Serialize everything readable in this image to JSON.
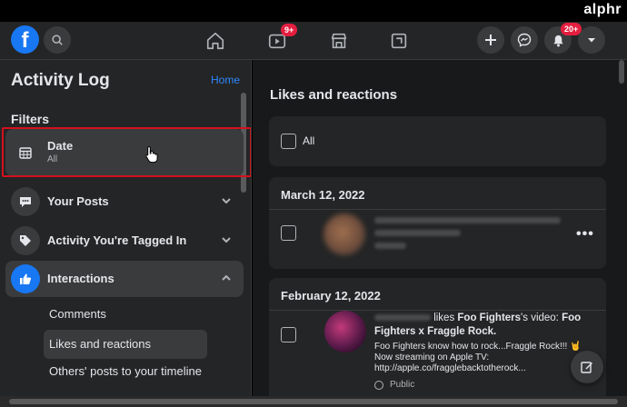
{
  "watermark": "alphr",
  "topbar": {
    "logo": "f",
    "watch_badge": "9+",
    "notif_badge": "20+"
  },
  "sidebar": {
    "title": "Activity Log",
    "home_link": "Home",
    "filters_heading": "Filters",
    "date": {
      "label": "Date",
      "value": "All"
    },
    "items": [
      {
        "label": "Your Posts"
      },
      {
        "label": "Activity You're Tagged In"
      },
      {
        "label": "Interactions"
      }
    ],
    "sub_items": [
      {
        "label": "Comments"
      },
      {
        "label": "Likes and reactions"
      },
      {
        "label": "Others' posts to your timeline"
      }
    ]
  },
  "main": {
    "title": "Likes and reactions",
    "select_all_label": "All",
    "group1": {
      "date": "March 12, 2022",
      "more": "•••"
    },
    "group2": {
      "date": "February 12, 2022",
      "likes_text": " likes ",
      "page": "Foo Fighters",
      "possessive_video": "'s video: ",
      "video_title": "Foo Fighters x Fraggle Rock.",
      "body": "Foo Fighters know how to rock...Fraggle Rock!!! 🤘\nNow streaming on Apple TV:\nhttp://apple.co/fragglebacktotherock...",
      "privacy": "Public"
    }
  },
  "colors": {
    "accent": "#1877f2",
    "link": "#2d88ff",
    "badge": "#e41e3f",
    "highlight_box": "#d5101e"
  }
}
